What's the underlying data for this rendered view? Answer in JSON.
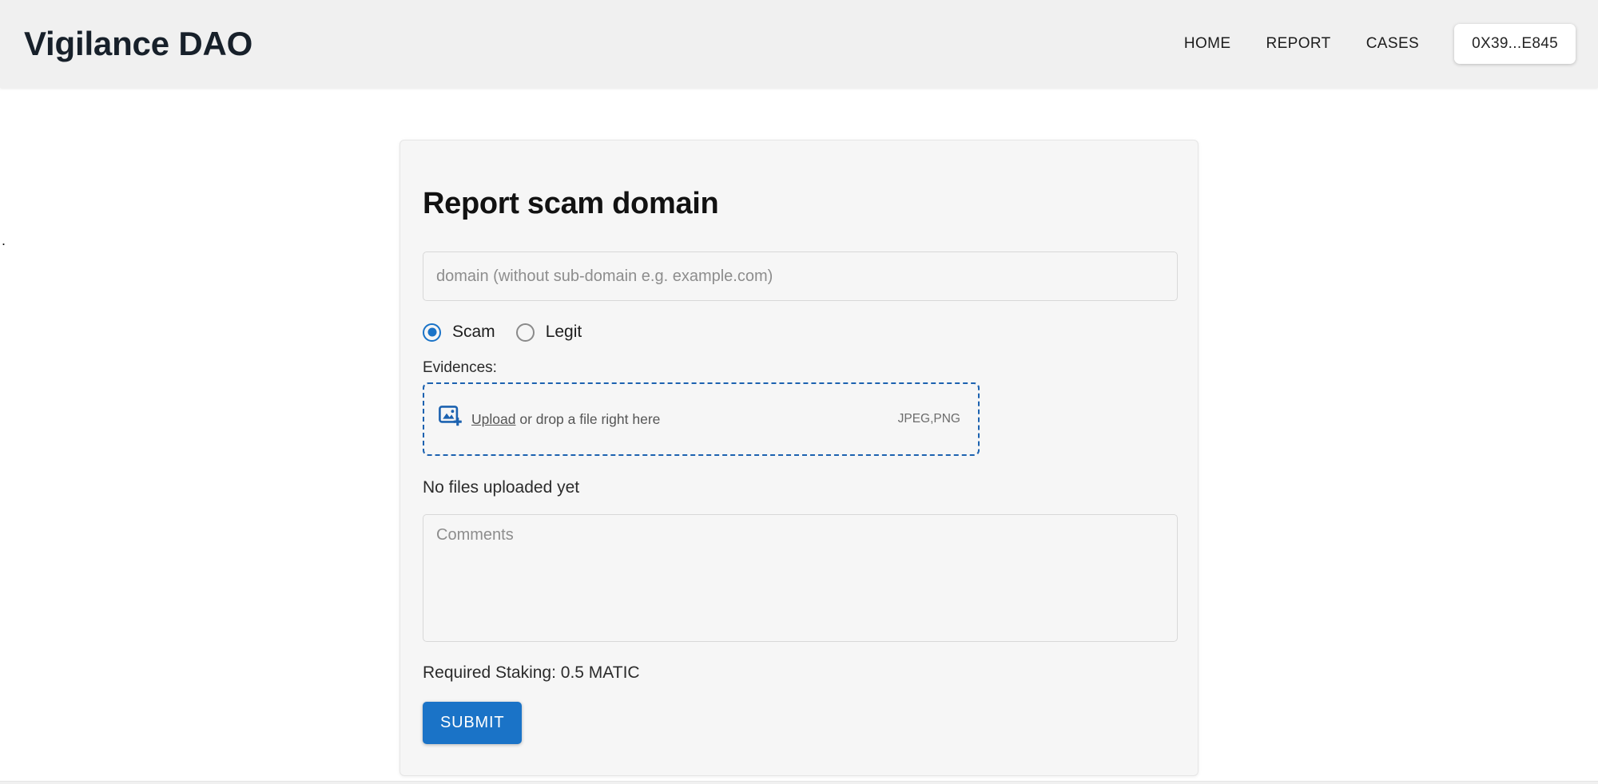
{
  "header": {
    "brand": "Vigilance DAO",
    "nav": [
      {
        "label": "HOME",
        "name": "nav-home"
      },
      {
        "label": "REPORT",
        "name": "nav-report"
      },
      {
        "label": "CASES",
        "name": "nav-cases"
      }
    ],
    "wallet_label": "0X39...E845"
  },
  "page": {
    "stray_dot": "."
  },
  "card": {
    "title": "Report scam domain",
    "domain_field": {
      "value": "",
      "placeholder": "domain (without sub-domain e.g. example.com)"
    },
    "verdict": {
      "options": [
        {
          "label": "Scam",
          "selected": true
        },
        {
          "label": "Legit",
          "selected": false
        }
      ],
      "selected_value": "Scam"
    },
    "evidences": {
      "label": "Evidences:",
      "upload_link": "Upload",
      "drop_hint": " or drop a file right here",
      "formats": "JPEG,PNG",
      "icon": "add-photo-icon",
      "status": "No files uploaded yet"
    },
    "comments_field": {
      "value": "",
      "placeholder": "Comments"
    },
    "staking_text": "Required Staking: 0.5 MATIC",
    "submit_label": "SUBMIT"
  },
  "colors": {
    "accent_blue": "#1a73c7",
    "dropzone_border": "#1c62b0",
    "header_bg": "#f0f0f0",
    "card_bg": "#f6f6f6",
    "page_bg": "#ffffff"
  }
}
